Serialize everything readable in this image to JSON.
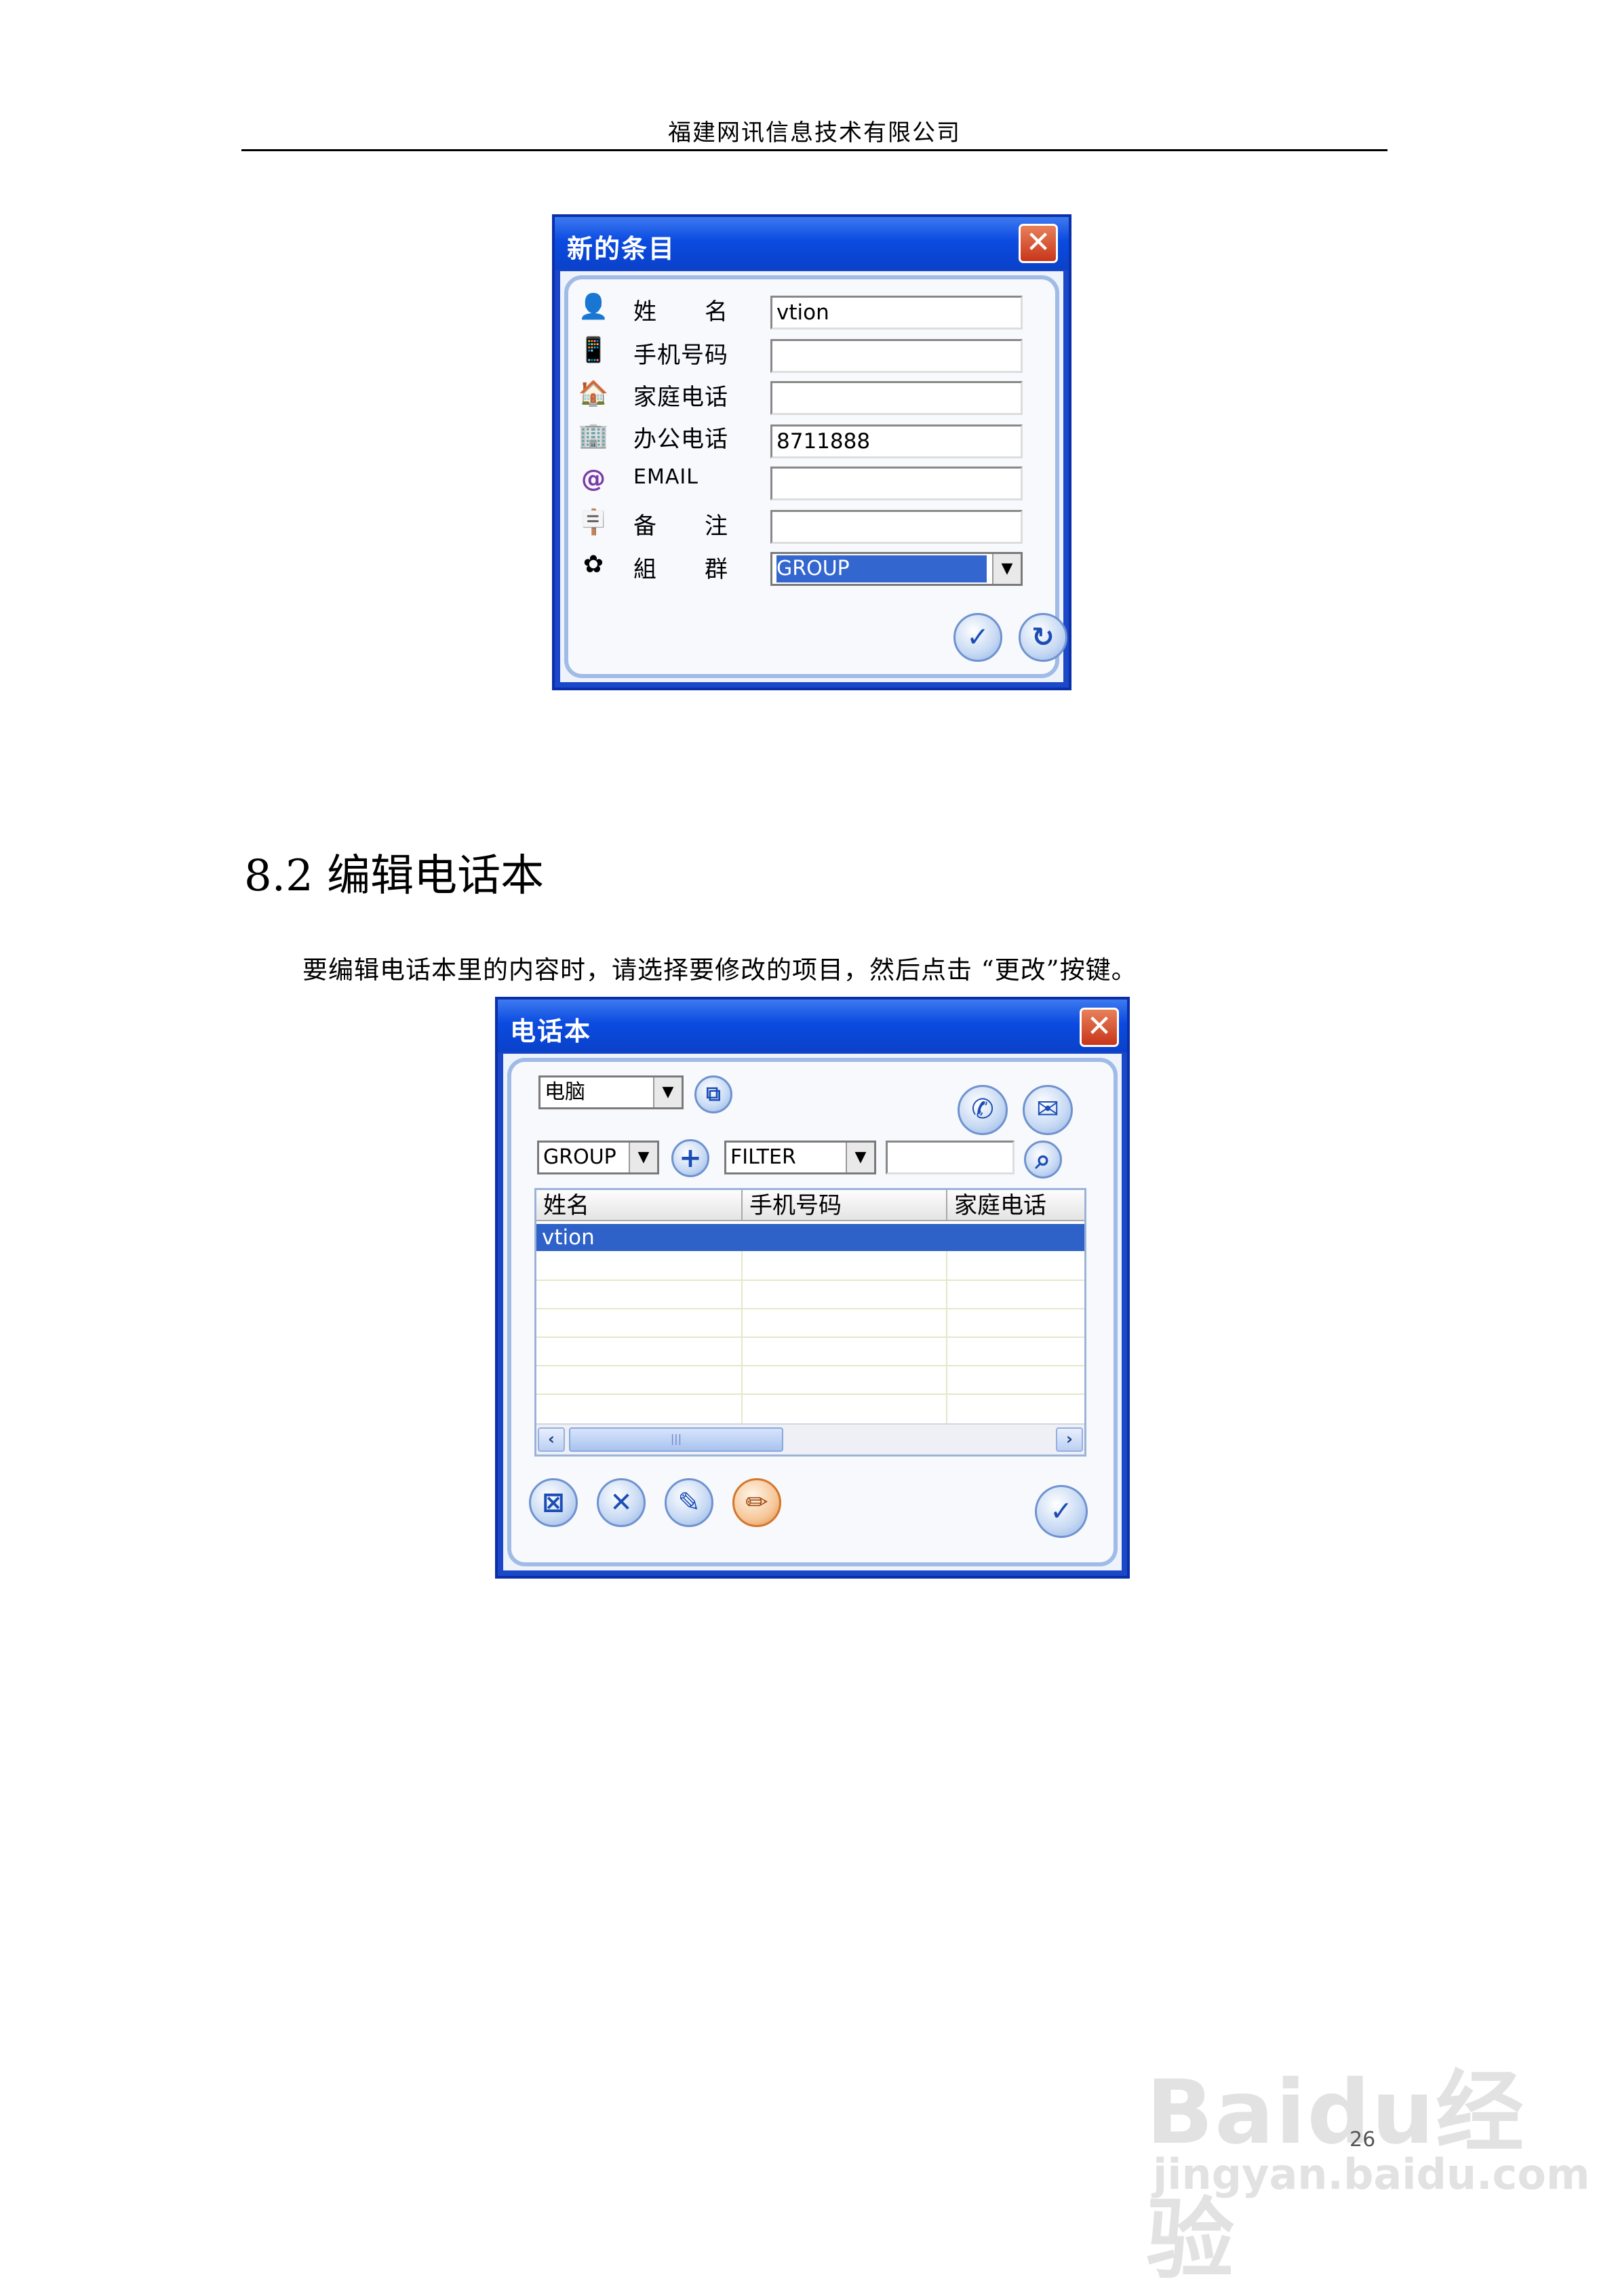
{
  "header": {
    "company": "福建网讯信息技术有限公司"
  },
  "dialog1": {
    "title": "新的条目",
    "close_glyph": "✕",
    "fields": [
      {
        "label": "姓　　名",
        "value": "vtion",
        "icon": "contact-icon"
      },
      {
        "label": "手机号码",
        "value": "",
        "icon": "mobile-phone-icon"
      },
      {
        "label": "家庭电话",
        "value": "",
        "icon": "house-icon"
      },
      {
        "label": "办公电话",
        "value": "8711888",
        "icon": "office-building-icon"
      },
      {
        "label": "EMAIL",
        "value": "",
        "icon": "at-sign-icon"
      },
      {
        "label": "备　　注",
        "value": "",
        "icon": "signpost-icon"
      },
      {
        "label": "組　　群",
        "value": "GROUP",
        "icon": "group-icon"
      }
    ],
    "ok_glyph": "✓",
    "reset_glyph": "↻"
  },
  "section": {
    "heading": "8.2 编辑电话本",
    "paragraph": "要编辑电话本里的内容时，请选择要修改的项目，然后点击 “更改”按键。"
  },
  "dialog2": {
    "title": "电话本",
    "close_glyph": "✕",
    "source_select": "电脑",
    "group_select": "GROUP",
    "filter_select": "FILTER",
    "filter_input": "",
    "columns": [
      "姓名",
      "手机号码",
      "家庭电话"
    ],
    "rows": [
      {
        "name": "vtion",
        "mobile": "",
        "home": ""
      }
    ],
    "scroll_thumb_glyph": "|||",
    "buttons": {
      "copy_glyph": "⧉",
      "call_glyph": "✆",
      "mail_glyph": "✉",
      "add_glyph": "+",
      "search_glyph": "⌕",
      "delete_all_glyph": "⊠",
      "delete_glyph": "✕",
      "new_glyph": "✎",
      "edit_glyph": "✏",
      "ok_glyph": "✓"
    }
  },
  "footer": {
    "page_number": "26"
  },
  "watermark": {
    "brand": "Baidu经验",
    "url": "jingyan.baidu.com"
  }
}
